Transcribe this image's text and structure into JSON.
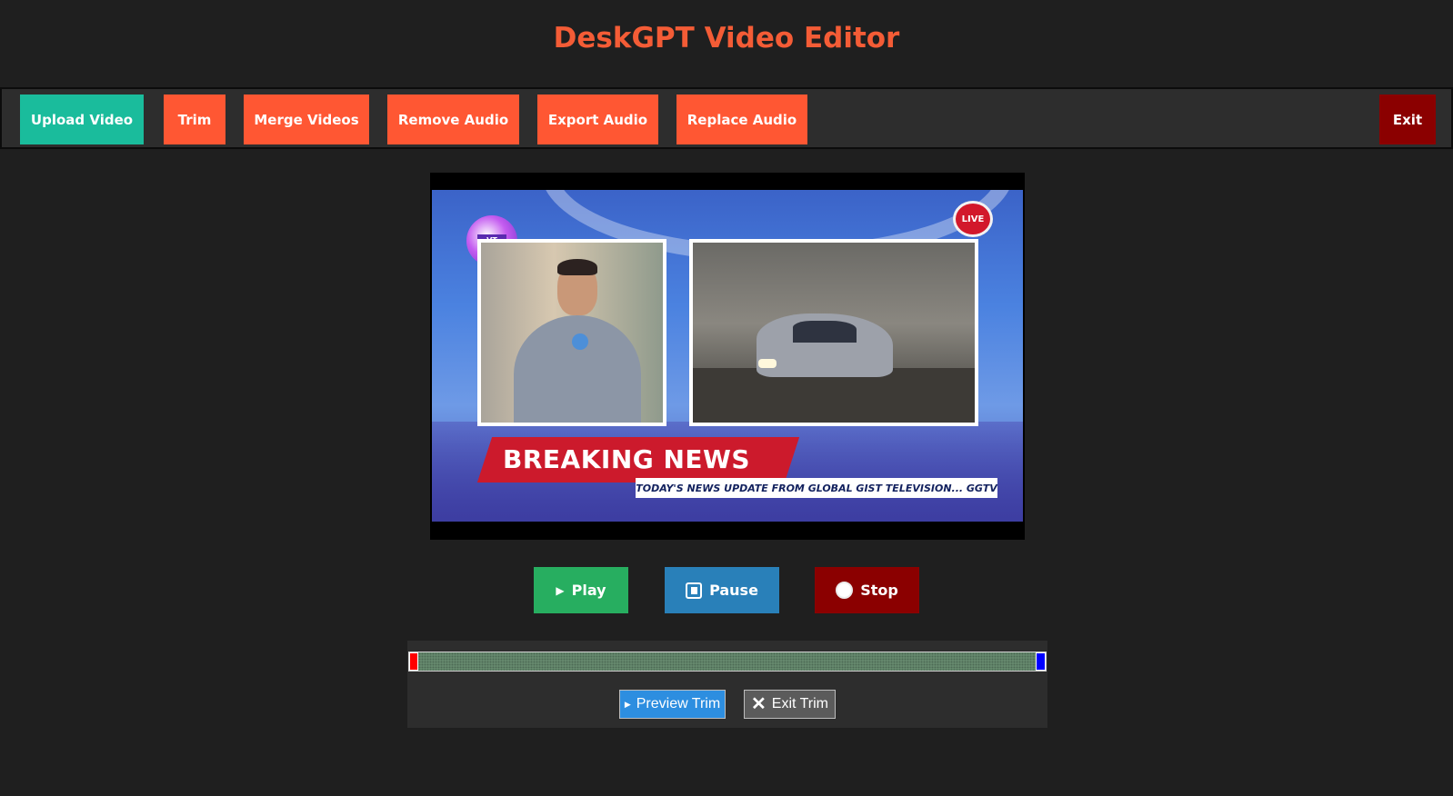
{
  "app": {
    "title": "DeskGPT Video Editor"
  },
  "toolbar": {
    "upload_label": "Upload Video",
    "trim_label": "Trim",
    "merge_label": "Merge Videos",
    "remove_audio_label": "Remove Audio",
    "export_audio_label": "Export Audio",
    "replace_audio_label": "Replace Audio",
    "exit_label": "Exit"
  },
  "video": {
    "live_badge": "LIVE",
    "logo_text": "VT TGS",
    "headline": "BREAKING NEWS",
    "ticker": "TODAY'S NEWS UPDATE FROM GLOBAL GIST TELEVISION... GGTV"
  },
  "controls": {
    "play_label": "Play",
    "pause_label": "Pause",
    "stop_label": "Stop"
  },
  "trim": {
    "preview_label": "Preview Trim",
    "exit_label": "Exit Trim"
  },
  "colors": {
    "accent": "#ff5733",
    "title": "#f45c36",
    "upload": "#1abc9c",
    "exit": "#8b0000",
    "play": "#27ae60",
    "pause": "#2980b9",
    "stop": "#8b0000",
    "background": "#1f1f1f",
    "panel": "#2d2d2d"
  },
  "icons": {
    "play": "play-triangle-icon",
    "pause": "pause-square-icon",
    "stop": "stop-circle-icon",
    "preview": "play-triangle-icon",
    "exit_trim": "close-x-icon"
  }
}
